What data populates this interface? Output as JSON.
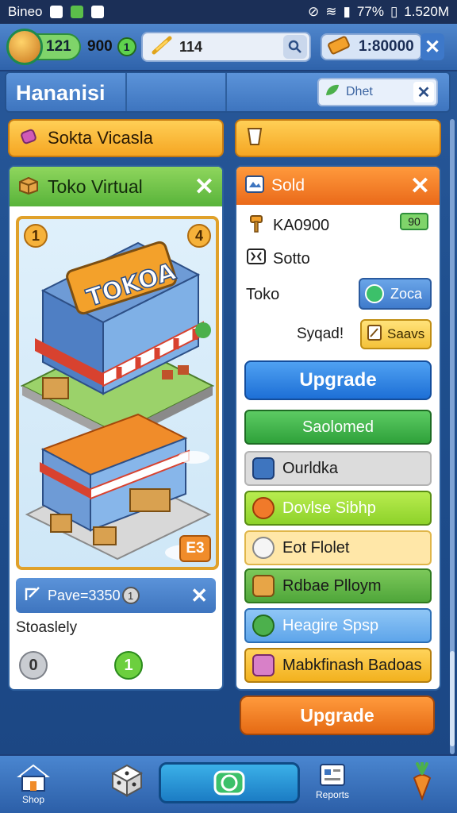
{
  "status_bar": {
    "carrier": "Bineo",
    "battery": "77%",
    "time": "1.520M"
  },
  "top_bar": {
    "level": "121",
    "coins": "900",
    "coin_badge": "1",
    "search_value": "114",
    "gems": "1:80000"
  },
  "header": {
    "title": "Hananisi",
    "search_label": "Dhet"
  },
  "left_panel": {
    "tab_label": "Sokta Vicasla",
    "card_title": "Toko Virtual",
    "art_sign": "TOKOA",
    "art_badge_left": "1",
    "art_badge_right": "4",
    "art_corner": "E3",
    "pave_label": "Pave=3350",
    "pave_coin": "1",
    "slot_label": "Stoaslely",
    "circle_grey": "0",
    "circle_green": "1"
  },
  "right_panel": {
    "card_title": "Sold",
    "row1_value": "KA0900",
    "row1_chip": "90",
    "row2_label": "Sotto",
    "row3_label": "Toko",
    "zoca_label": "Zoca",
    "sybad_label": "Syqad!",
    "saves_label": "Saavs",
    "upgrade_label": "Upgrade",
    "list": [
      {
        "label": "Saolomed"
      },
      {
        "label": "Ourldka"
      },
      {
        "label": "Dovlse Sibhp"
      },
      {
        "label": "Eot Flolet"
      },
      {
        "label": "Rdbae Plloym"
      },
      {
        "label": "Heagire Spsp"
      },
      {
        "label": "Mabkfinash Badoas"
      }
    ]
  },
  "bottom_upgrade_label": "Upgrade",
  "bottom_nav": {
    "home_label": "Shop",
    "reports_label": "Reports"
  },
  "colors": {
    "panel_blue": "#3e75bf",
    "green": "#58b33a",
    "orange": "#ea6a1a",
    "gold": "#f5a623",
    "upgrade_blue": "#1d6fd6"
  },
  "icons": {
    "avatar": "avatar-icon",
    "search": "search-icon",
    "close": "close-icon",
    "shop": "shop-icon",
    "dice": "dice-icon",
    "reports": "reports-icon",
    "carrot": "carrot-icon"
  }
}
